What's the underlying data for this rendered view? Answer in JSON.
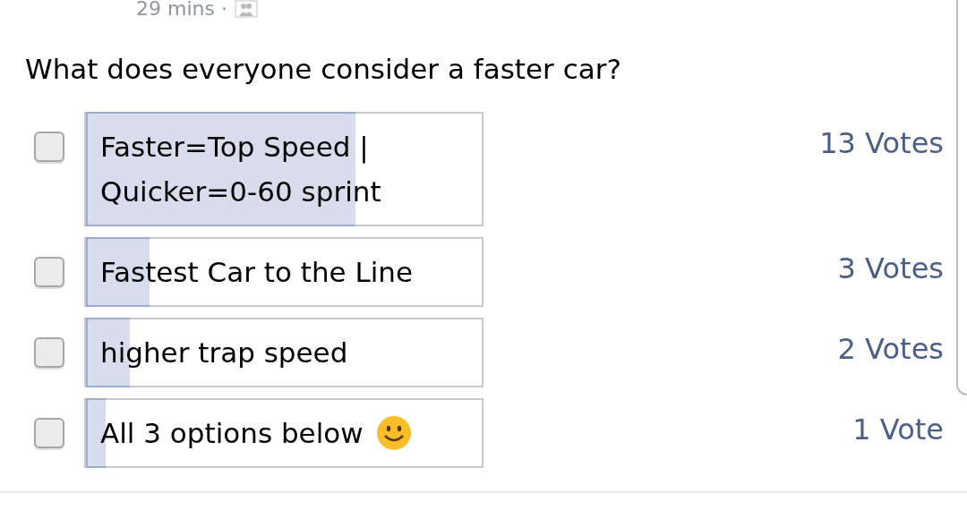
{
  "post": {
    "time": "29 mins ·"
  },
  "poll": {
    "question": "What does everyone consider a faster car?",
    "options": [
      {
        "kind": "plain",
        "label": "Faster=Top Speed | Quicker=0-60 sprint",
        "checked": false,
        "level": 0.68,
        "votes": "13 Votes"
      },
      {
        "kind": "plain",
        "label": "Fastest Car to the Line",
        "checked": false,
        "level": 0.16,
        "votes": "3 Votes"
      },
      {
        "kind": "plain",
        "label": "higher trap speed",
        "checked": false,
        "level": 0.11,
        "votes": "2 Votes"
      },
      {
        "kind": "smiley",
        "label": "All 3 options below",
        "checked": false,
        "level": 0.05,
        "votes": "1 Vote"
      }
    ]
  }
}
